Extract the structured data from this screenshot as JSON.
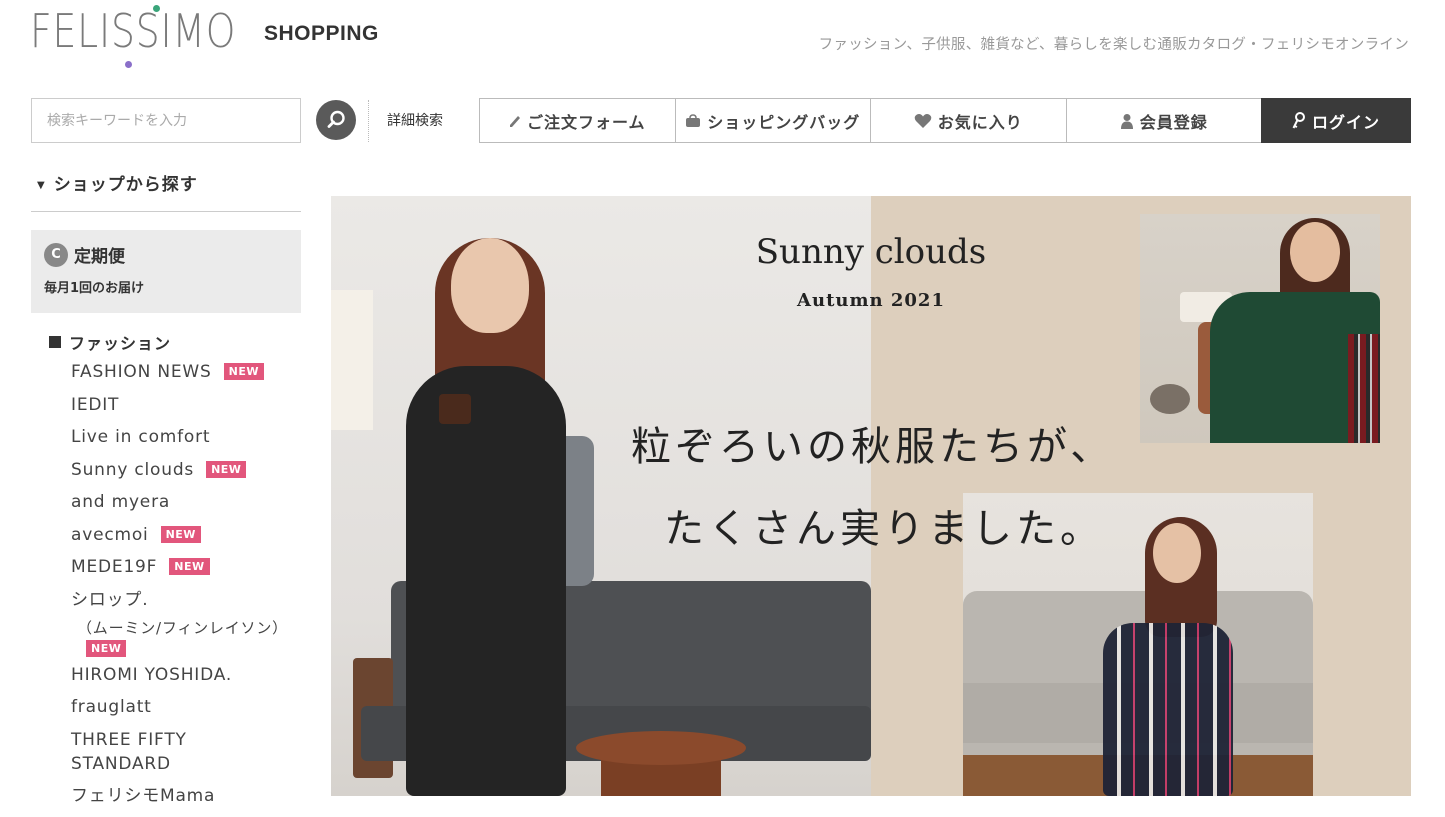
{
  "header": {
    "logo_text": "FELISSIMO",
    "logo_sub": "SHOPPING",
    "tagline": "ファッション、子供服、雑貨など、暮らしを楽しむ通販カタログ・フェリシモオンライン"
  },
  "search": {
    "placeholder": "検索キーワードを入力",
    "advanced_label": "詳細検索"
  },
  "nav": {
    "order_form": "ご注文フォーム",
    "shopping_bag": "ショッピングバッグ",
    "favorites": "お気に入り",
    "register": "会員登録",
    "login": "ログイン"
  },
  "sidebar": {
    "shop_heading": "ショップから探す",
    "teiki_title": "定期便",
    "teiki_sub": "毎月1回のお届け",
    "category_heading": "ファッション",
    "new_badge": "NEW",
    "items": [
      {
        "label": "FASHION NEWS",
        "new": true
      },
      {
        "label": "IEDIT",
        "new": false
      },
      {
        "label": "Live in comfort",
        "new": false
      },
      {
        "label": "Sunny clouds",
        "new": true
      },
      {
        "label": "and myera",
        "new": false
      },
      {
        "label": "avecmoi",
        "new": true
      },
      {
        "label": "MEDE19F",
        "new": true
      },
      {
        "label": "シロップ.",
        "new": false
      },
      {
        "label": "（ムーミン/フィンレイソン）",
        "new": true
      },
      {
        "label": "HIROMI YOSHIDA.",
        "new": false
      },
      {
        "label": "frauglatt",
        "new": false
      },
      {
        "label": "THREE FIFTY STANDARD",
        "new": false
      },
      {
        "label": "フェリシモMama",
        "new": false
      }
    ]
  },
  "banner": {
    "title": "Sunny clouds",
    "subtitle": "Autumn 2021",
    "copy_line1": "粒ぞろいの秋服たちが、",
    "copy_line2": "たくさん実りました。"
  },
  "colors": {
    "accent_badge": "#e2567c",
    "login_bg": "#3a3a3a",
    "banner_beige": "#ddcfbd"
  }
}
